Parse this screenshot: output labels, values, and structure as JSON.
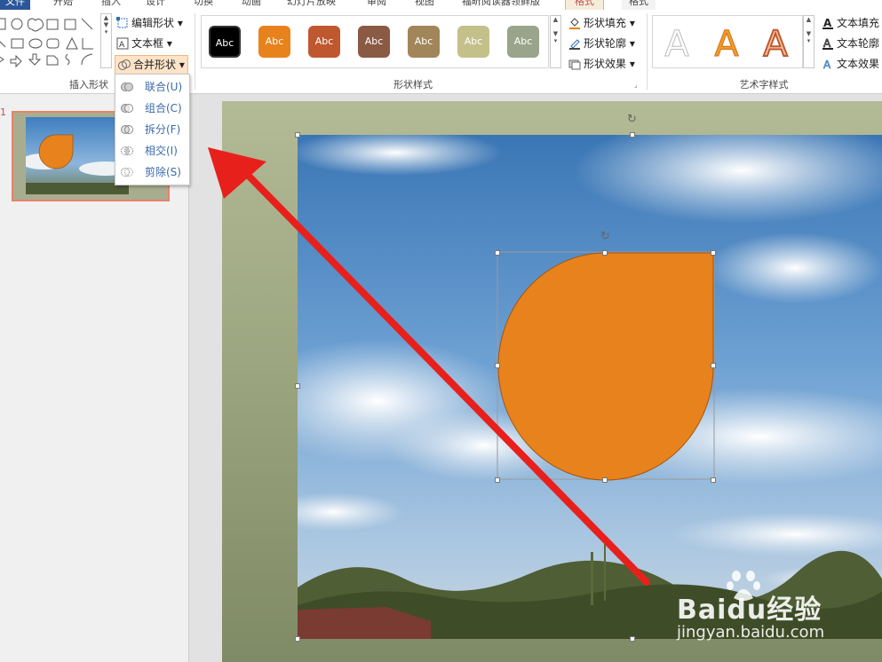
{
  "ribbon": {
    "tabs": [
      "文件",
      "开始",
      "插入",
      "设计",
      "切换",
      "动画",
      "幻灯片放映",
      "审阅",
      "视图",
      "福昕阅读器领鲜版",
      "格式",
      "格式"
    ],
    "insert_shapes": {
      "edit_shape_label": "编辑形状",
      "text_box_label": "文本框",
      "merge_shapes_label": "合并形状",
      "group_label": "插入形状"
    },
    "shape_styles": {
      "tiles": [
        {
          "label": "Abc",
          "color": "#000000"
        },
        {
          "label": "Abc",
          "color": "#e8821c"
        },
        {
          "label": "Abc",
          "color": "#c0582f"
        },
        {
          "label": "Abc",
          "color": "#8b5a44"
        },
        {
          "label": "Abc",
          "color": "#a1865a"
        },
        {
          "label": "Abc",
          "color": "#c4c08a"
        },
        {
          "label": "Abc",
          "color": "#9aa48a"
        }
      ],
      "fill_label": "形状填充",
      "outline_label": "形状轮廓",
      "effects_label": "形状效果",
      "group_label": "形状样式"
    },
    "wordart": {
      "letters": [
        "A",
        "A",
        "A"
      ],
      "text_fill_label": "文本填充",
      "text_outline_label": "文本轮廓",
      "text_effects_label": "文本效果",
      "group_label": "艺术字样式"
    }
  },
  "merge_menu": {
    "items": [
      {
        "label": "联合(U)"
      },
      {
        "label": "组合(C)"
      },
      {
        "label": "拆分(F)"
      },
      {
        "label": "相交(I)"
      },
      {
        "label": "剪除(S)"
      }
    ]
  },
  "slide_panel": {
    "slide_number": "1"
  },
  "watermark": {
    "brand": "Baidu经验",
    "url": "jingyan.baidu.com"
  },
  "colors": {
    "accent_orange": "#e8821c",
    "arrow_red": "#e8201c",
    "selection_border": "#e9826a"
  }
}
